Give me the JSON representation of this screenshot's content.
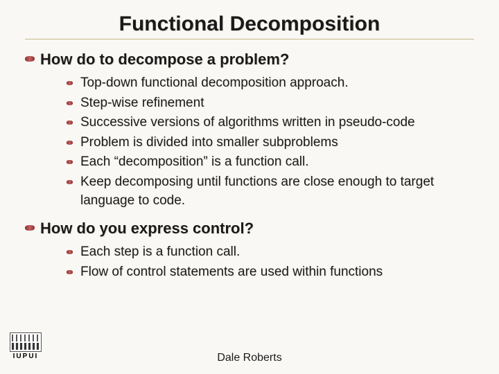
{
  "title": "Functional Decomposition",
  "sections": [
    {
      "heading": "How do to decompose a problem?",
      "items": [
        "Top-down functional decomposition approach.",
        "Step-wise refinement",
        "Successive versions of algorithms written in pseudo-code",
        "Problem is divided into smaller subproblems",
        "Each “decomposition” is a function call.",
        "Keep decomposing until functions are close enough to target language to code."
      ]
    },
    {
      "heading": "How do you express control?",
      "items": [
        "Each step is a function call.",
        "Flow of control statements are used within functions"
      ]
    }
  ],
  "footer": {
    "author": "Dale Roberts"
  },
  "logo": {
    "text": "IUPUI"
  }
}
